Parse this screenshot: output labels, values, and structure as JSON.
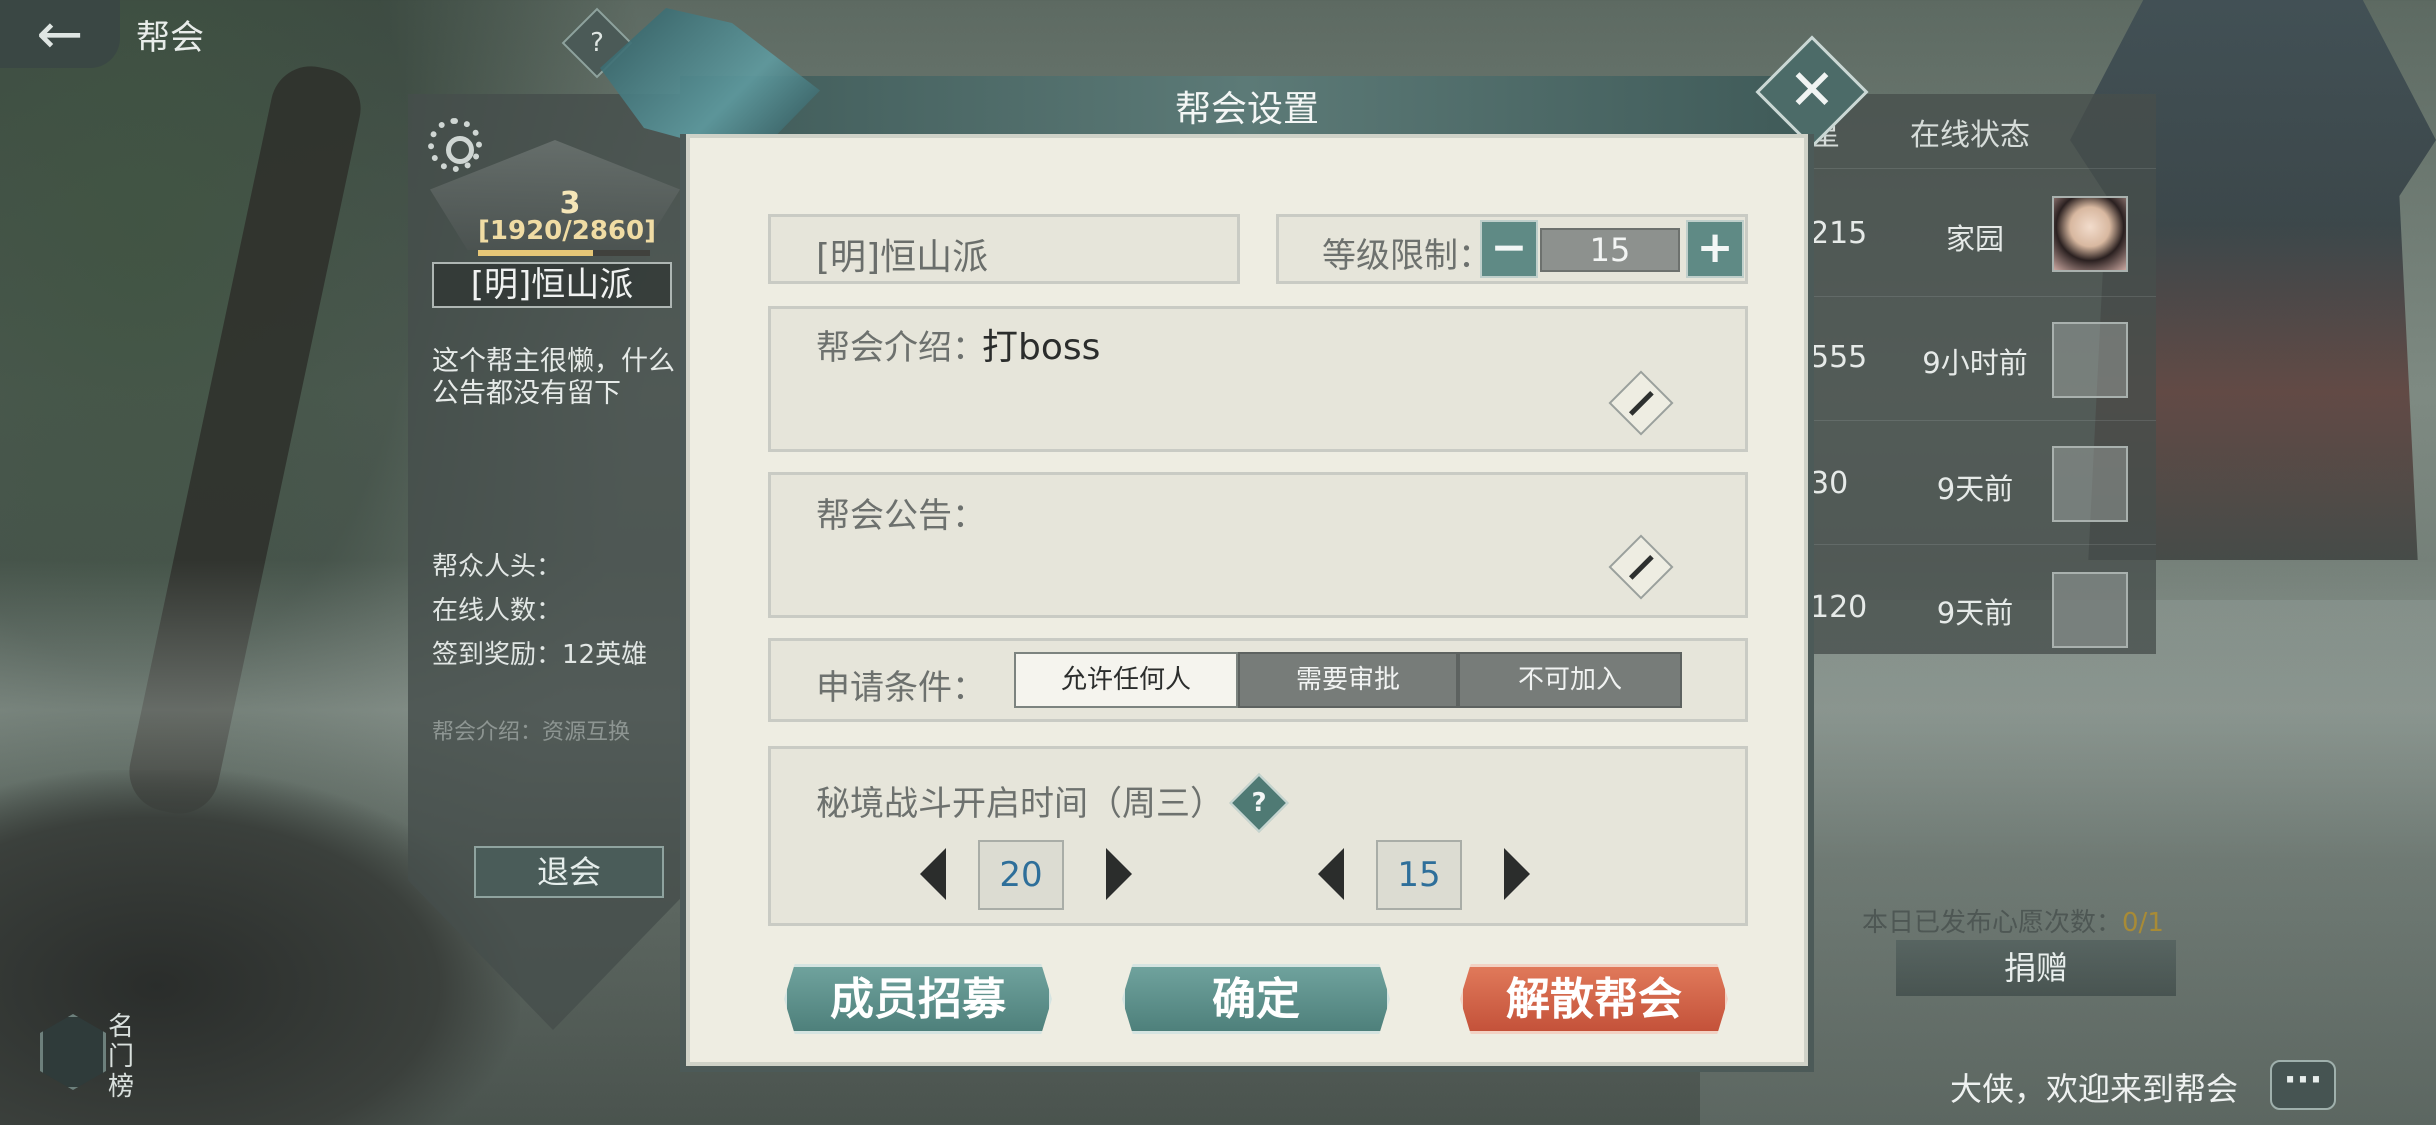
{
  "header": {
    "back_label": "←",
    "title": "帮会",
    "help_label": "?"
  },
  "guild_info": {
    "level": "3",
    "exp": "[1920/2860]",
    "exp_progress": 0.671,
    "name": "[明]恒山派",
    "description": "这个帮主很懒，什么\n公告都没有留下",
    "members_label": "帮众人头：",
    "online_label": "在线人数：",
    "sign_reward_label": "签到奖励：12英雄",
    "intro_faint": "帮会介绍：资源互换",
    "quit_label": "退会"
  },
  "rank": {
    "label": "名\n门\n榜"
  },
  "members": {
    "header_col1": "星",
    "header_col2": "在线状态",
    "rows": [
      {
        "num": "215",
        "status": "家园",
        "avatar": "online"
      },
      {
        "num": "555",
        "status": "9小时前",
        "avatar": "offline"
      },
      {
        "num": "30",
        "status": "9天前",
        "avatar": "offline"
      },
      {
        "num": "120",
        "status": "9天前",
        "avatar": "offline"
      }
    ]
  },
  "wish": {
    "text": "本日已发布心愿次数：",
    "count": "0/1",
    "donate_label": "捐赠"
  },
  "welcome": "大侠，欢迎来到帮会",
  "modal": {
    "title": "帮会设置",
    "close_label": "✕",
    "guild_name": "[明]恒山派",
    "level_limit_label": "等级限制：",
    "level_limit_value": "15",
    "minus_label": "−",
    "plus_label": "+",
    "intro_label": "帮会介绍：",
    "intro_value": "打boss",
    "notice_label": "帮会公告：",
    "notice_value": "",
    "apply_label": "申请条件：",
    "apply_options": [
      "允许任何人",
      "需要审批",
      "不可加入"
    ],
    "apply_selected": "允许任何人",
    "battle_label": "秘境战斗开启时间（周三）",
    "battle_help": "?",
    "battle_hour": "20",
    "battle_minute": "15",
    "btn_recruit": "成员招募",
    "btn_confirm": "确定",
    "btn_disband": "解散帮会"
  },
  "colors": {
    "accent_teal": "#5f8a85",
    "danger_red": "#c4523a",
    "panel_bg": "#eeede2",
    "time_value": "#2e6f9a"
  }
}
